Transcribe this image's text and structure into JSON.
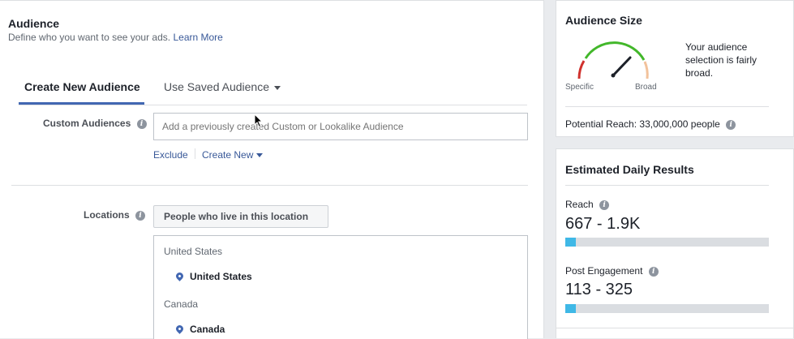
{
  "audience": {
    "title": "Audience",
    "subtitle": "Define who you want to see your ads.",
    "learn_more": "Learn More"
  },
  "tabs": [
    {
      "label": "Create New Audience",
      "active": true
    },
    {
      "label": "Use Saved Audience",
      "active": false
    }
  ],
  "custom_audiences": {
    "label": "Custom Audiences",
    "placeholder": "Add a previously created Custom or Lookalike Audience",
    "exclude": "Exclude",
    "create_new": "Create New"
  },
  "locations": {
    "label": "Locations",
    "selector": "People who live in this location",
    "groups": [
      {
        "country": "United States",
        "item": "United States"
      },
      {
        "country": "Canada",
        "item": "Canada"
      }
    ]
  },
  "audience_size": {
    "title": "Audience Size",
    "gauge_min": "Specific",
    "gauge_max": "Broad",
    "description": "Your audience selection is fairly broad.",
    "potential_reach": "Potential Reach: 33,000,000 people"
  },
  "estimated": {
    "title": "Estimated Daily Results",
    "reach_label": "Reach",
    "reach_value": "667 - 1.9K",
    "reach_fill": 0.05,
    "engagement_label": "Post Engagement",
    "engagement_value": "113 - 325",
    "engagement_fill": 0.05
  },
  "colors": {
    "accent": "#385898",
    "tab_underline": "#4267b2",
    "bar_fill": "#3fb8e6",
    "gauge_red": "#d0312d",
    "gauge_green": "#42b72a",
    "gauge_peach": "#f2c29b"
  }
}
